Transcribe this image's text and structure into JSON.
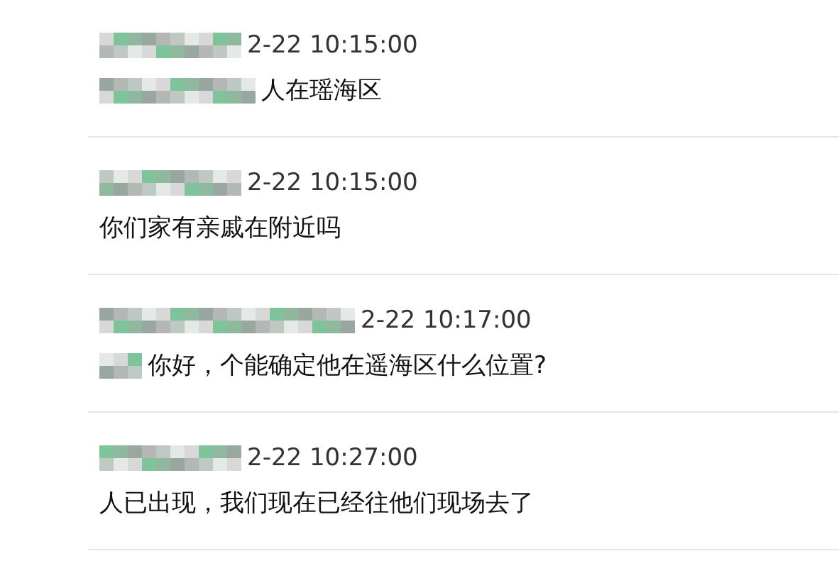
{
  "messages": [
    {
      "time": "2-22 10:15:00",
      "text": "人在瑶海区",
      "text_obscured": true
    },
    {
      "time": "2-22 10:15:00",
      "text": "你们家有亲戚在附近吗",
      "text_obscured": false
    },
    {
      "time": "2-22 10:17:00",
      "text": "你好，个能确定他在遥海区什么位置?",
      "text_obscured": true
    },
    {
      "time": "2-22 10:27:00",
      "text": "人已出现，我们现在已经往他们现场去了",
      "text_obscured": false
    }
  ]
}
